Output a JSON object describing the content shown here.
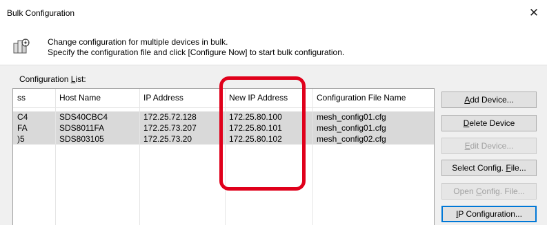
{
  "window": {
    "title": "Bulk Configuration",
    "close_glyph": "✕"
  },
  "banner": {
    "icon": "devices-config-icon",
    "line1": "Change configuration for multiple devices in bulk.",
    "line2": "Specify the configuration file and click [Configure Now] to start bulk configuration."
  },
  "config_list": {
    "label_prefix": "Configuration ",
    "label_mnemonic": "L",
    "label_suffix": "ist:",
    "columns": [
      "ss",
      "Host Name",
      "IP Address",
      "New IP Address",
      "Configuration File Name"
    ],
    "rows": [
      [
        "C4",
        "SDS40CBC4",
        "172.25.72.128",
        "172.25.80.100",
        "mesh_config01.cfg"
      ],
      [
        "FA",
        "SDS8011FA",
        "172.25.73.207",
        "172.25.80.101",
        "mesh_config01.cfg"
      ],
      [
        ")5",
        "SDS803105",
        "172.25.73.20",
        "172.25.80.102",
        "mesh_config02.cfg"
      ]
    ]
  },
  "buttons": [
    {
      "pre": "",
      "ul": "A",
      "post": "dd Device...",
      "enabled": true,
      "focused": false
    },
    {
      "pre": "",
      "ul": "D",
      "post": "elete Device",
      "enabled": true,
      "focused": false
    },
    {
      "pre": "",
      "ul": "E",
      "post": "dit Device...",
      "enabled": false,
      "focused": false
    },
    {
      "pre": "Select Config. ",
      "ul": "F",
      "post": "ile...",
      "enabled": true,
      "focused": false
    },
    {
      "pre": "Open ",
      "ul": "C",
      "post": "onfig. File...",
      "enabled": false,
      "focused": false
    },
    {
      "pre": "",
      "ul": "I",
      "post": "P Configuration...",
      "enabled": true,
      "focused": true
    }
  ],
  "colors": {
    "highlight": "#e0001b",
    "selected_row": "#d9d9d9",
    "dialog_bg": "#f0f0f0"
  }
}
